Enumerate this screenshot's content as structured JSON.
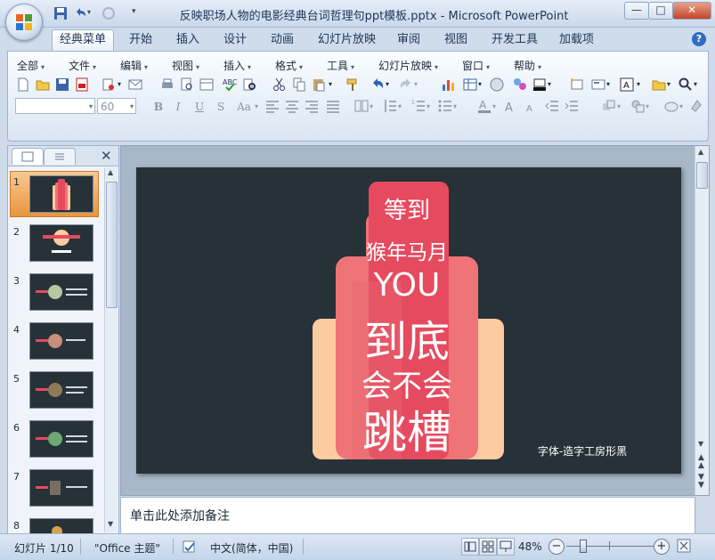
{
  "window": {
    "title": "反映职场人物的电影经典台词哲理句ppt模板.pptx - Microsoft PowerPoint",
    "min_glyph": "—",
    "max_glyph": "□",
    "close_glyph": "✕"
  },
  "ribbon_tabs": [
    "经典菜单",
    "开始",
    "插入",
    "设计",
    "动画",
    "幻灯片放映",
    "审阅",
    "视图",
    "开发工具",
    "加载项"
  ],
  "help_glyph": "?",
  "menus": [
    "全部",
    "文件",
    "编辑",
    "视图",
    "插入",
    "格式",
    "工具",
    "幻灯片放映",
    "窗口",
    "帮助"
  ],
  "font": {
    "name_value": "",
    "size_value": "60"
  },
  "format_buttons": {
    "bold": "B",
    "italic": "I",
    "underline": "U",
    "strike": "S",
    "case": "Aa"
  },
  "panel": {
    "close_glyph": "✕"
  },
  "slides": {
    "numbers": [
      "1",
      "2",
      "3",
      "4",
      "5",
      "6",
      "7",
      "8"
    ]
  },
  "slide": {
    "line1": "等到",
    "line2": "猴年马月",
    "line3": "YOU",
    "line4": "到底",
    "line5": "会不会",
    "line6": "跳槽",
    "footer": "字体-造字工房形黑"
  },
  "notes": {
    "placeholder": "单击此处添加备注"
  },
  "status": {
    "slide_counter": "幻灯片 1/10",
    "theme": "\"Office 主题\"",
    "language": "中文(简体，中国)",
    "zoom": "48%"
  },
  "colors": {
    "slide_bg": "#263238",
    "peach": "#fccb9f",
    "pink": "#ef7478",
    "crimson": "#e54a5f"
  }
}
